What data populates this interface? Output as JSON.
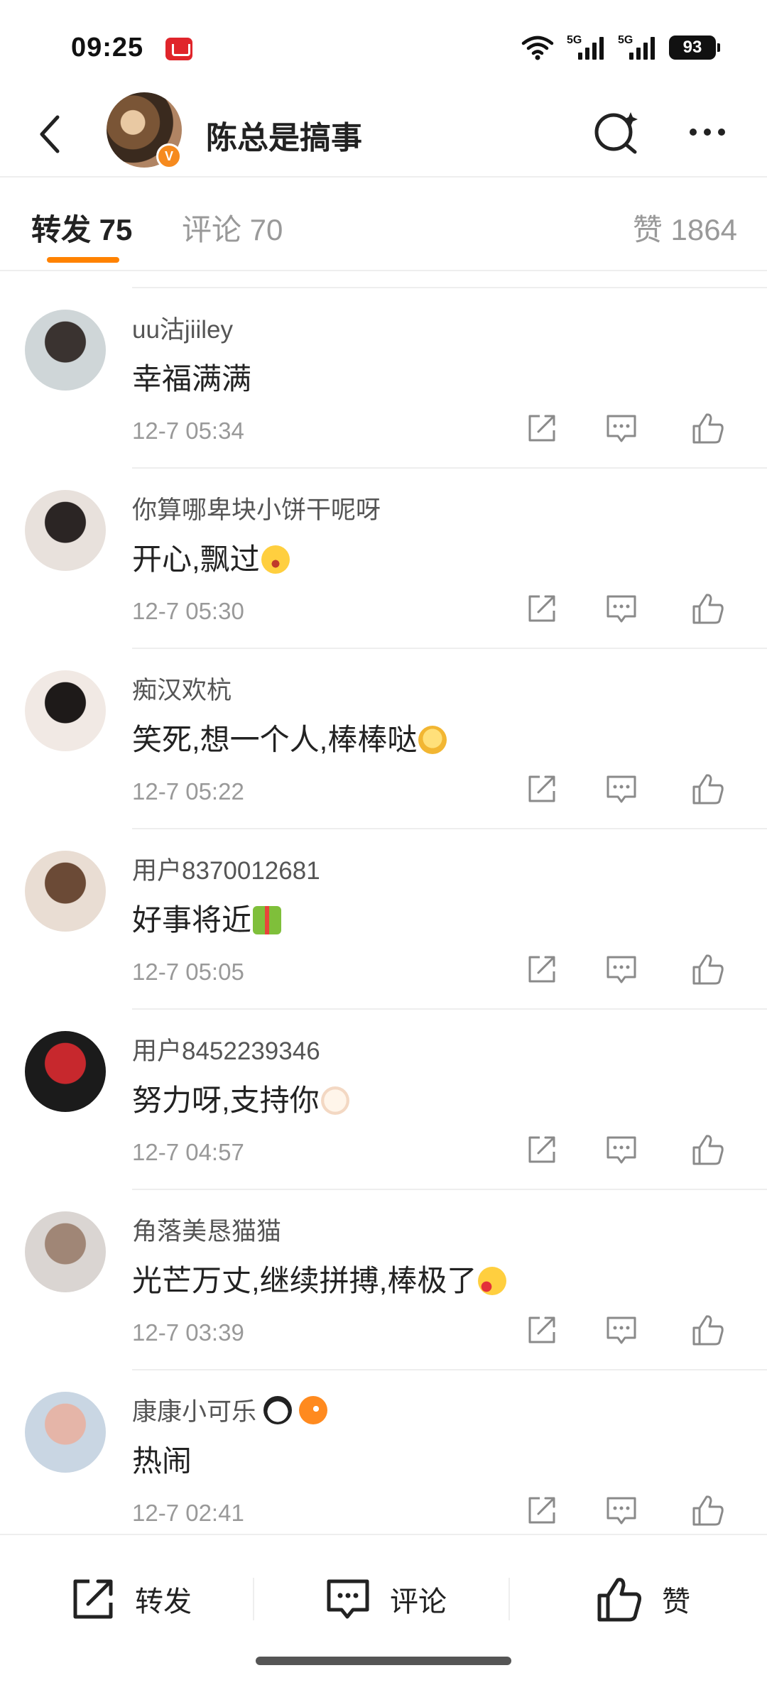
{
  "status_bar": {
    "time": "09:25",
    "network_1": "5G",
    "network_2": "5G",
    "battery": "93"
  },
  "header": {
    "title": "陈总是搞事",
    "verified_mark": "V",
    "icons": [
      "back-arrow-icon",
      "search-icon",
      "more-icon"
    ]
  },
  "tabs": {
    "repost": "转发 75",
    "comment": "评论 70",
    "like": "赞 1864",
    "active": "repost",
    "accent_color": "#ff8200"
  },
  "items": [
    {
      "name": "uu沽jiiley",
      "text": "幸福满满",
      "emoji": "",
      "time": "12-7 05:34",
      "avatar_colors": [
        "#cfd6d8",
        "#3a3330"
      ]
    },
    {
      "name": "你算哪卑块小饼干呢呀",
      "text": "开心,飘过",
      "emoji": "surprised-face",
      "time": "12-7 05:30",
      "avatar_colors": [
        "#e8e1dc",
        "#2b2524"
      ]
    },
    {
      "name": "痴汉欢杭",
      "text": "笑死,想一个人,棒棒哒",
      "emoji": "sleepy-face",
      "time": "12-7 05:22",
      "avatar_colors": [
        "#f1e9e4",
        "#1e1a19"
      ]
    },
    {
      "name": "用户8370012681",
      "text": "好事将近",
      "emoji": "gift",
      "time": "12-7 05:05",
      "avatar_colors": [
        "#e9ddd3",
        "#6b4a36"
      ]
    },
    {
      "name": "用户8452239346",
      "text": "努力呀,支持你",
      "emoji": "baby-face",
      "time": "12-7 04:57",
      "avatar_colors": [
        "#1b1b1b",
        "#c7282d"
      ]
    },
    {
      "name": "角落美恳猫猫",
      "text": "光芒万丈,继续拼搏,棒极了",
      "emoji": "heart-face",
      "time": "12-7 03:39",
      "avatar_colors": [
        "#dad5d2",
        "#a08676"
      ]
    },
    {
      "name": "康康小可乐",
      "text": "热闹",
      "emoji": "",
      "name_emojis": [
        "panda",
        "fish"
      ],
      "time": "12-7 02:41",
      "avatar_colors": [
        "#c9d6e3",
        "#e5b5a8"
      ]
    }
  ],
  "bottom_bar": {
    "repost": "转发",
    "comment": "评论",
    "like": "赞"
  }
}
